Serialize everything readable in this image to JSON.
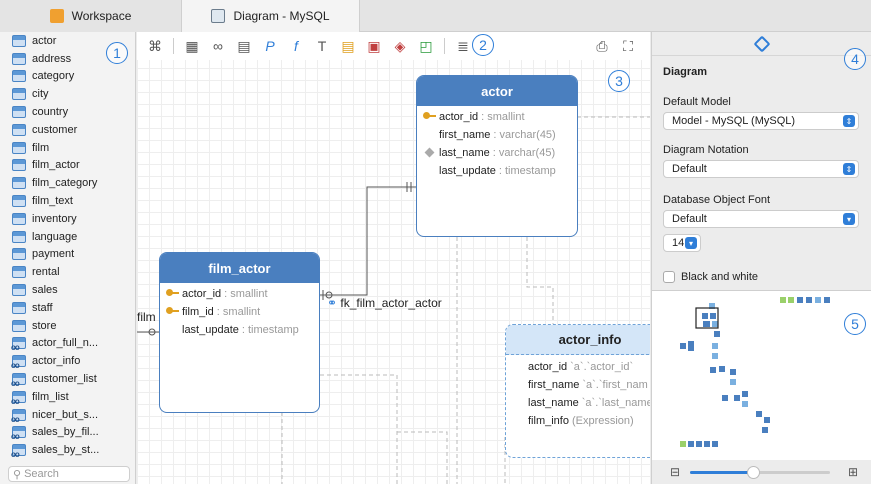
{
  "tabs": [
    {
      "label": "Workspace"
    },
    {
      "label": "Diagram - MySQL"
    }
  ],
  "sidebar": {
    "items": [
      {
        "label": "actor",
        "kind": "table"
      },
      {
        "label": "address",
        "kind": "table"
      },
      {
        "label": "category",
        "kind": "table"
      },
      {
        "label": "city",
        "kind": "table"
      },
      {
        "label": "country",
        "kind": "table"
      },
      {
        "label": "customer",
        "kind": "table"
      },
      {
        "label": "film",
        "kind": "table"
      },
      {
        "label": "film_actor",
        "kind": "table"
      },
      {
        "label": "film_category",
        "kind": "table"
      },
      {
        "label": "film_text",
        "kind": "table"
      },
      {
        "label": "inventory",
        "kind": "table"
      },
      {
        "label": "language",
        "kind": "table"
      },
      {
        "label": "payment",
        "kind": "table"
      },
      {
        "label": "rental",
        "kind": "table"
      },
      {
        "label": "sales",
        "kind": "table"
      },
      {
        "label": "staff",
        "kind": "table"
      },
      {
        "label": "store",
        "kind": "table"
      },
      {
        "label": "actor_full_n...",
        "kind": "view"
      },
      {
        "label": "actor_info",
        "kind": "view"
      },
      {
        "label": "customer_list",
        "kind": "view"
      },
      {
        "label": "film_list",
        "kind": "view"
      },
      {
        "label": "nicer_but_s...",
        "kind": "view"
      },
      {
        "label": "sales_by_fil...",
        "kind": "view"
      },
      {
        "label": "sales_by_st...",
        "kind": "view"
      }
    ],
    "search_placeholder": "Search"
  },
  "badges": [
    "1",
    "2",
    "3",
    "4",
    "5"
  ],
  "entities": {
    "actor": {
      "title": "actor",
      "columns": [
        {
          "name": "actor_id",
          "type": ": smallint",
          "icon": "key"
        },
        {
          "name": "first_name",
          "type": ": varchar(45)",
          "icon": ""
        },
        {
          "name": "last_name",
          "type": ": varchar(45)",
          "icon": "diamond"
        },
        {
          "name": "last_update",
          "type": ": timestamp",
          "icon": ""
        }
      ]
    },
    "film_actor": {
      "title": "film_actor",
      "columns": [
        {
          "name": "actor_id",
          "type": ": smallint",
          "icon": "key"
        },
        {
          "name": "film_id",
          "type": ": smallint",
          "icon": "key"
        },
        {
          "name": "last_update",
          "type": ": timestamp",
          "icon": ""
        }
      ]
    },
    "actor_info": {
      "title": "actor_info",
      "columns": [
        {
          "name": "actor_id",
          "type": " `a`.`actor_id`"
        },
        {
          "name": "first_name",
          "type": " `a`.`first_nam"
        },
        {
          "name": "last_name",
          "type": " `a`.`last_name"
        },
        {
          "name": "film_info",
          "type": " (Expression)"
        }
      ]
    }
  },
  "relationship_label": "fk_film_actor_actor",
  "film_edge_label": "film",
  "properties": {
    "title": "Diagram",
    "default_model_label": "Default Model",
    "default_model_value": "Model - MySQL (MySQL)",
    "notation_label": "Diagram Notation",
    "notation_value": "Default",
    "font_label": "Database Object Font",
    "font_value": "Default",
    "font_size": "14",
    "bw_label": "Black and white",
    "bw_checked": false
  },
  "zoom": {
    "level": 0.45
  },
  "colors": {
    "accent": "#2f7ed8",
    "entity_header": "#4a7fbf",
    "view_header": "#d4e6f8"
  }
}
